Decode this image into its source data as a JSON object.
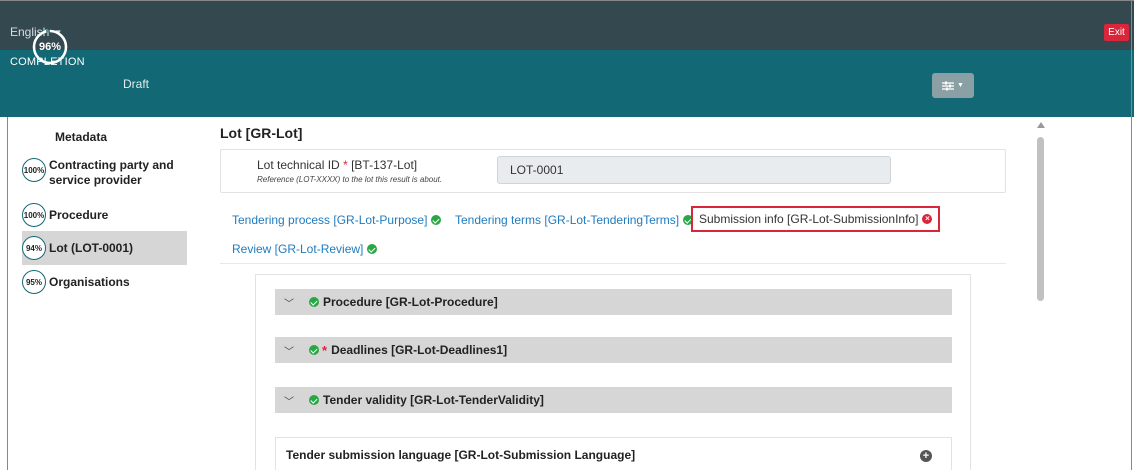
{
  "topbar": {
    "language": "English",
    "exit_label": "Exit"
  },
  "completion": {
    "title": "COMPLETION",
    "percent_label": "96%",
    "percent_value": 0.96,
    "status": "Draft"
  },
  "sidebar": {
    "title": "Metadata",
    "items": [
      {
        "percent": "100%",
        "label": "Contracting party and service provider"
      },
      {
        "percent": "100%",
        "label": "Procedure"
      },
      {
        "percent": "94%",
        "label": "Lot (LOT-0001)"
      },
      {
        "percent": "95%",
        "label": "Organisations"
      }
    ]
  },
  "main": {
    "title": "Lot [GR-Lot]",
    "field": {
      "label": "Lot technical ID",
      "required_mark": "*",
      "code": "[BT-137-Lot]",
      "help": "Reference (LOT-XXXX) to the lot this result is about.",
      "value": "LOT-0001"
    },
    "tabs": [
      {
        "label": "Tendering process  [GR-Lot-Purpose]",
        "status": "ok"
      },
      {
        "label": "Tendering terms  [GR-Lot-TenderingTerms]",
        "status": "ok"
      },
      {
        "label": "Submission info  [GR-Lot-SubmissionInfo]",
        "status": "error"
      },
      {
        "label": "Review  [GR-Lot-Review]",
        "status": "ok"
      }
    ],
    "sections": [
      {
        "label": "Procedure  [GR-Lot-Procedure]",
        "required": false
      },
      {
        "label": "Deadlines  [GR-Lot-Deadlines1]",
        "required": true
      },
      {
        "label": "Tender validity  [GR-Lot-TenderValidity]",
        "required": false
      }
    ],
    "submission_language": "Tender submission language  [GR-Lot-Submission Language]"
  },
  "colors": {
    "topbar": "#33484f",
    "completion_bar": "#136875",
    "exit": "#d9263a",
    "link": "#1f7bbf",
    "ok": "#28a745",
    "error": "#d9263a"
  }
}
